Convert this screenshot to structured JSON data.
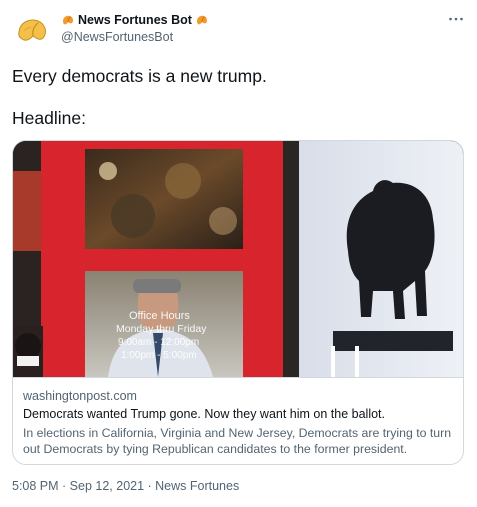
{
  "author": {
    "display_name": "News Fortunes Bot",
    "handle": "@NewsFortunesBot",
    "avatar_icon": "fortune-cookie-icon",
    "name_emoji_icon": "fortune-cookie-emoji-icon"
  },
  "menu": {
    "more_icon": "more-horizontal-icon"
  },
  "tweet": {
    "line1": "Every democrats is a new trump.",
    "line2": "Headline:"
  },
  "card": {
    "image_text": {
      "line1": "Office Hours",
      "line2": "Monday thru Friday",
      "line3": "9:00am - 12:00pm",
      "line4": "1:00pm - 5:00pm"
    },
    "domain": "washingtonpost.com",
    "title": "Democrats wanted Trump gone. Now they want him on the ballot.",
    "description": "In elections in California, Virginia and New Jersey, Democrats are trying to turn out Democrats by tying Republican candidates to the former president."
  },
  "footer": {
    "time": "5:08 PM",
    "date": "Sep 12, 2021",
    "source": "News Fortunes",
    "separator": " · "
  },
  "colors": {
    "text_primary": "#0f1419",
    "text_secondary": "#536471",
    "border": "#cfd9de",
    "door_red": "#d8242c",
    "cookie": "#f4c04a"
  }
}
